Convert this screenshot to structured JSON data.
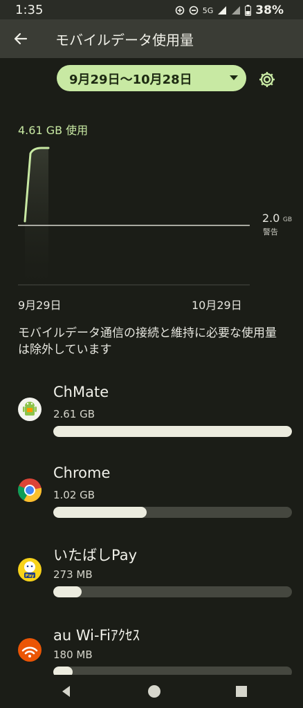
{
  "status_bar": {
    "time": "1:35",
    "network": "5G",
    "battery": "38%"
  },
  "app_bar": {
    "title": "モバイルデータ使用量"
  },
  "cycle": {
    "range_label": "9月29日〜10月28日"
  },
  "summary": {
    "usage_label": "4.61 GB 使用"
  },
  "chart_data": {
    "type": "area",
    "x_labels": [
      "9月29日",
      "10月29日"
    ],
    "warning": {
      "value": "2.0",
      "unit": "GB",
      "label": "警告"
    }
  },
  "notice": "モバイルデータ通信の接続と維持に必要な使用量は除外しています",
  "apps": [
    {
      "name": "ChMate",
      "size": "2.61 GB",
      "fraction": 1.0,
      "icon": "chmate-android-icon"
    },
    {
      "name": "Chrome",
      "size": "1.02 GB",
      "fraction": 0.39,
      "icon": "chrome-icon"
    },
    {
      "name": "いたばしPay",
      "size": "273 MB",
      "fraction": 0.12,
      "icon": "itabashi-pay-icon"
    },
    {
      "name": "au Wi-Fiｱｸｾｽ",
      "size": "180 MB",
      "fraction": 0.08,
      "icon": "au-wifi-icon"
    }
  ],
  "colors": {
    "accent": "#c8e9a3",
    "background": "#1b1d17",
    "bar_fill": "#ececdf",
    "bar_track": "#45473f"
  }
}
